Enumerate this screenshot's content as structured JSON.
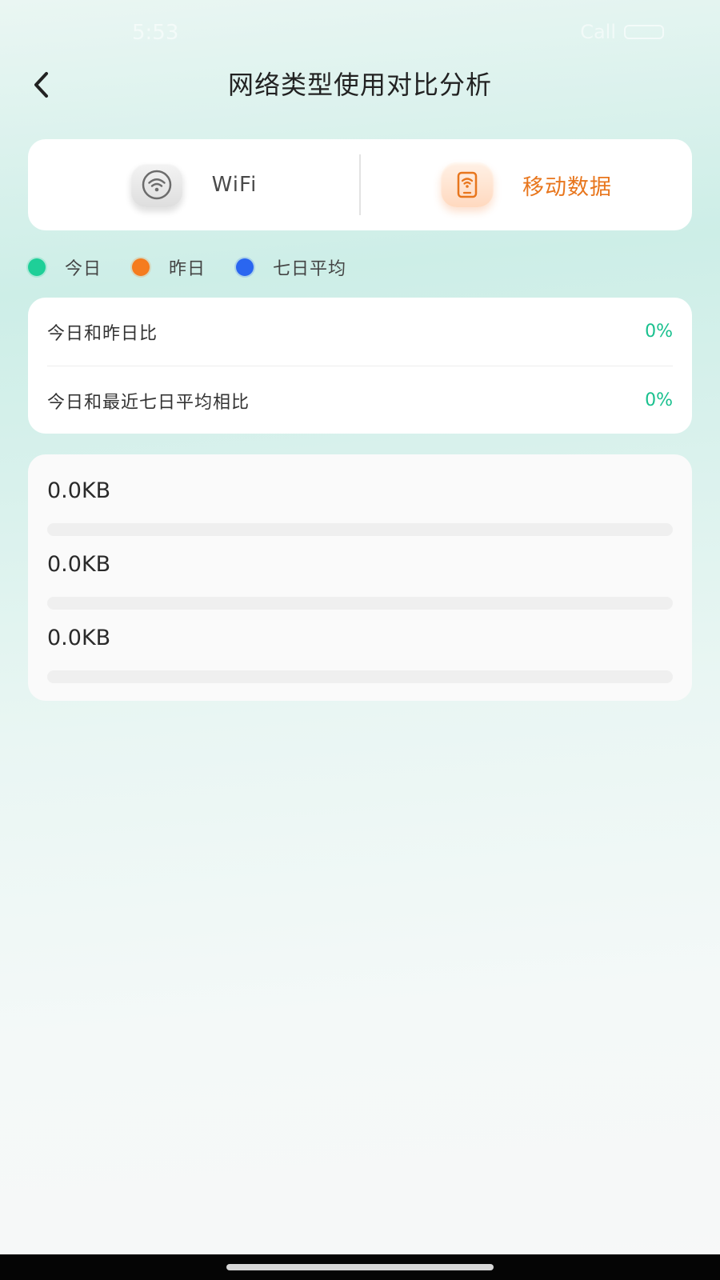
{
  "status_bar": {
    "time": "5:53",
    "signal_text": "Call"
  },
  "header": {
    "title": "网络类型使用对比分析"
  },
  "network_types": {
    "wifi_label": "WiFi",
    "mobile_label": "移动数据",
    "wifi_icon": "wifi-icon",
    "mobile_icon": "mobile-data-icon",
    "selected": "mobile"
  },
  "legend": [
    {
      "label": "今日",
      "color": "#1fcf98"
    },
    {
      "label": "昨日",
      "color": "#f57c1f"
    },
    {
      "label": "七日平均",
      "color": "#2a66f0"
    }
  ],
  "comparison": [
    {
      "label": "今日和昨日比",
      "value": "0%"
    },
    {
      "label": "今日和最近七日平均相比",
      "value": "0%"
    }
  ],
  "usage": [
    {
      "value": "0.0KB",
      "fill_percent": 0
    },
    {
      "value": "0.0KB",
      "fill_percent": 0
    },
    {
      "value": "0.0KB",
      "fill_percent": 0
    }
  ],
  "colors": {
    "accent_green": "#19c08e",
    "accent_orange": "#e8761d"
  }
}
